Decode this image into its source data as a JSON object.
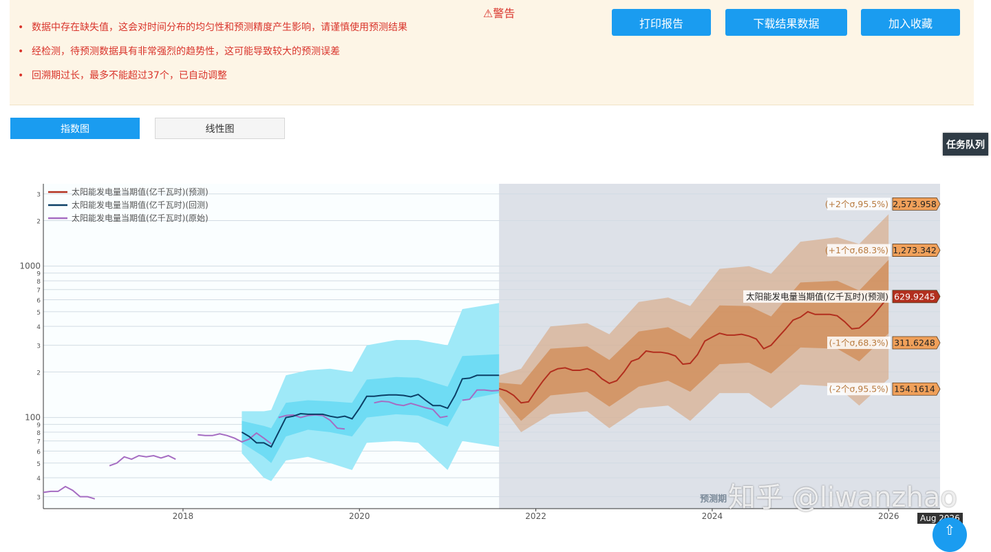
{
  "warning": {
    "title": "⚠警告",
    "items": [
      "数据中存在缺失值，这会对时间分布的均匀性和预测精度产生影响，请谨慎使用预测结果",
      "经检测，待预测数据具有非常强烈的趋势性，这可能导致较大的预测误差",
      "回溯期过长，最多不能超过37个，已自动调整"
    ]
  },
  "actions": {
    "print": "打印报告",
    "download": "下载结果数据",
    "favorite": "加入收藏"
  },
  "tabs": {
    "exp": "指数图",
    "linear": "线性图"
  },
  "side": {
    "queue": "任务队列"
  },
  "overlay": {
    "aug": "Aug 2026",
    "scroll_top": "⇧"
  },
  "watermark": "知乎 @liwanzhao",
  "colors": {
    "accent": "#1a9cf0",
    "pred": "#b22f1e",
    "back": "#0b3f66",
    "orig": "#a56cc2",
    "cyan": "#62dcf4",
    "orange": "#d6884a"
  },
  "chart_data": {
    "type": "line",
    "yscale": "log",
    "ylim": [
      25,
      3500
    ],
    "xlim": [
      "2016-06",
      "2026-08"
    ],
    "x_ticks": [
      "2018",
      "2020",
      "2022",
      "2024",
      "2026"
    ],
    "y_ticks": [
      {
        "v": 30,
        "t": "3"
      },
      {
        "v": 40,
        "t": "4"
      },
      {
        "v": 50,
        "t": "5"
      },
      {
        "v": 60,
        "t": "6"
      },
      {
        "v": 70,
        "t": "7"
      },
      {
        "v": 80,
        "t": "8"
      },
      {
        "v": 90,
        "t": "9"
      },
      {
        "v": 100,
        "t": "100"
      },
      {
        "v": 200,
        "t": "2"
      },
      {
        "v": 300,
        "t": "3"
      },
      {
        "v": 400,
        "t": "4"
      },
      {
        "v": 500,
        "t": "5"
      },
      {
        "v": 600,
        "t": "6"
      },
      {
        "v": 700,
        "t": "7"
      },
      {
        "v": 800,
        "t": "8"
      },
      {
        "v": 900,
        "t": "9"
      },
      {
        "v": 1000,
        "t": "1000"
      },
      {
        "v": 2000,
        "t": "2"
      },
      {
        "v": 3000,
        "t": "3"
      }
    ],
    "forecast_region_label": "预测期",
    "forecast_start": "2021-08",
    "legend": [
      {
        "name": "太阳能发电量当期值(亿千瓦时)(预测)",
        "color": "#b22f1e"
      },
      {
        "name": "太阳能发电量当期值(亿千瓦时)(回测)",
        "color": "#0b3f66"
      },
      {
        "name": "太阳能发电量当期值(亿千瓦时)(原始)",
        "color": "#a56cc2"
      }
    ],
    "series": {
      "original": [
        [
          [
            "2016-06",
            32
          ],
          [
            "2016-07",
            32.5
          ],
          [
            "2016-08",
            32.5
          ],
          [
            "2016-09",
            35
          ],
          [
            "2016-10",
            33
          ],
          [
            "2016-11",
            30
          ],
          [
            "2016-12",
            30
          ],
          [
            "2017-01",
            29
          ]
        ],
        [
          [
            "2017-03",
            48
          ],
          [
            "2017-04",
            50
          ],
          [
            "2017-05",
            55
          ],
          [
            "2017-06",
            53
          ],
          [
            "2017-07",
            56
          ],
          [
            "2017-08",
            55
          ],
          [
            "2017-09",
            56
          ],
          [
            "2017-10",
            54
          ],
          [
            "2017-11",
            56
          ],
          [
            "2017-12",
            53
          ]
        ],
        [
          [
            "2018-03",
            77
          ],
          [
            "2018-04",
            76
          ],
          [
            "2018-05",
            76
          ],
          [
            "2018-06",
            78
          ],
          [
            "2018-07",
            76
          ],
          [
            "2018-08",
            73
          ],
          [
            "2018-09",
            69
          ],
          [
            "2018-10",
            72
          ],
          [
            "2018-11",
            79
          ],
          [
            "2018-12",
            73
          ],
          [
            "2019-01",
            67
          ]
        ],
        [
          [
            "2019-02",
            100
          ],
          [
            "2019-03",
            103
          ],
          [
            "2019-04",
            104
          ],
          [
            "2019-05",
            100
          ],
          [
            "2019-06",
            103
          ],
          [
            "2019-07",
            104
          ],
          [
            "2019-08",
            103
          ],
          [
            "2019-09",
            96
          ],
          [
            "2019-10",
            85
          ],
          [
            "2019-11",
            84
          ]
        ],
        [
          [
            "2020-03",
            125
          ],
          [
            "2020-04",
            128
          ],
          [
            "2020-05",
            127
          ],
          [
            "2020-06",
            122
          ],
          [
            "2020-07",
            120
          ],
          [
            "2020-08",
            124
          ],
          [
            "2020-09",
            120
          ],
          [
            "2020-10",
            116
          ],
          [
            "2020-11",
            113
          ],
          [
            "2020-12",
            100
          ],
          [
            "2021-01",
            102
          ]
        ],
        [
          [
            "2021-03",
            130
          ],
          [
            "2021-04",
            132
          ],
          [
            "2021-05",
            152
          ],
          [
            "2021-06",
            152
          ],
          [
            "2021-07",
            150
          ],
          [
            "2021-08",
            151
          ]
        ]
      ],
      "backtest": [
        [
          "2018-09",
          80
        ],
        [
          "2018-10",
          75
        ],
        [
          "2018-11",
          68
        ],
        [
          "2018-12",
          68
        ],
        [
          "2019-01",
          64
        ],
        [
          "2019-02",
          80
        ],
        [
          "2019-03",
          100
        ],
        [
          "2019-04",
          102
        ],
        [
          "2019-05",
          106
        ],
        [
          "2019-06",
          105
        ],
        [
          "2019-07",
          105
        ],
        [
          "2019-08",
          105
        ],
        [
          "2019-09",
          102
        ],
        [
          "2019-10",
          100
        ],
        [
          "2019-11",
          102
        ],
        [
          "2019-12",
          98
        ],
        [
          "2020-01",
          115
        ],
        [
          "2020-02",
          138
        ],
        [
          "2020-03",
          138
        ],
        [
          "2020-04",
          140
        ],
        [
          "2020-05",
          141
        ],
        [
          "2020-06",
          141
        ],
        [
          "2020-07",
          140
        ],
        [
          "2020-08",
          137
        ],
        [
          "2020-09",
          142
        ],
        [
          "2020-10",
          130
        ],
        [
          "2020-11",
          120
        ],
        [
          "2020-12",
          120
        ],
        [
          "2021-01",
          115
        ],
        [
          "2021-02",
          140
        ],
        [
          "2021-03",
          180
        ],
        [
          "2021-04",
          182
        ],
        [
          "2021-05",
          190
        ],
        [
          "2021-06",
          190
        ],
        [
          "2021-07",
          190
        ],
        [
          "2021-08",
          190
        ]
      ],
      "backtest_band1": {
        "lower": [
          [
            "2018-09",
            68
          ],
          [
            "2018-12",
            55
          ],
          [
            "2019-01",
            50
          ],
          [
            "2019-03",
            75
          ],
          [
            "2019-06",
            83
          ],
          [
            "2019-09",
            80
          ],
          [
            "2019-12",
            75
          ],
          [
            "2020-02",
            100
          ],
          [
            "2020-06",
            105
          ],
          [
            "2020-09",
            103
          ],
          [
            "2021-01",
            87
          ],
          [
            "2021-03",
            130
          ],
          [
            "2021-08",
            145
          ]
        ],
        "upper": [
          [
            "2018-09",
            95
          ],
          [
            "2018-12",
            88
          ],
          [
            "2019-01",
            85
          ],
          [
            "2019-03",
            125
          ],
          [
            "2019-06",
            130
          ],
          [
            "2019-09",
            128
          ],
          [
            "2019-12",
            125
          ],
          [
            "2020-02",
            178
          ],
          [
            "2020-06",
            185
          ],
          [
            "2020-09",
            183
          ],
          [
            "2021-01",
            160
          ],
          [
            "2021-03",
            255
          ],
          [
            "2021-08",
            262
          ]
        ]
      },
      "backtest_band2": {
        "lower": [
          [
            "2018-09",
            58
          ],
          [
            "2018-12",
            40
          ],
          [
            "2019-01",
            38
          ],
          [
            "2019-03",
            52
          ],
          [
            "2019-06",
            55
          ],
          [
            "2019-09",
            50
          ],
          [
            "2019-12",
            45
          ],
          [
            "2020-02",
            68
          ],
          [
            "2020-06",
            70
          ],
          [
            "2020-09",
            68
          ],
          [
            "2021-01",
            45
          ],
          [
            "2021-03",
            70
          ],
          [
            "2021-08",
            64
          ]
        ],
        "upper": [
          [
            "2018-09",
            110
          ],
          [
            "2018-12",
            110
          ],
          [
            "2019-01",
            112
          ],
          [
            "2019-03",
            190
          ],
          [
            "2019-06",
            205
          ],
          [
            "2019-09",
            210
          ],
          [
            "2019-12",
            200
          ],
          [
            "2020-02",
            300
          ],
          [
            "2020-06",
            325
          ],
          [
            "2020-09",
            325
          ],
          [
            "2021-01",
            300
          ],
          [
            "2021-03",
            520
          ],
          [
            "2021-08",
            570
          ]
        ]
      },
      "forecast": [
        [
          "2021-08",
          155
        ],
        [
          "2021-09",
          150
        ],
        [
          "2021-10",
          140
        ],
        [
          "2021-11",
          125
        ],
        [
          "2021-12",
          127
        ],
        [
          "2022-01",
          150
        ],
        [
          "2022-02",
          175
        ],
        [
          "2022-03",
          200
        ],
        [
          "2022-04",
          210
        ],
        [
          "2022-05",
          213
        ],
        [
          "2022-06",
          205
        ],
        [
          "2022-07",
          205
        ],
        [
          "2022-08",
          210
        ],
        [
          "2022-09",
          200
        ],
        [
          "2022-10",
          180
        ],
        [
          "2022-11",
          168
        ],
        [
          "2022-12",
          175
        ],
        [
          "2023-01",
          200
        ],
        [
          "2023-02",
          235
        ],
        [
          "2023-03",
          245
        ],
        [
          "2023-04",
          275
        ],
        [
          "2023-05",
          270
        ],
        [
          "2023-06",
          270
        ],
        [
          "2023-07",
          265
        ],
        [
          "2023-08",
          255
        ],
        [
          "2023-09",
          225
        ],
        [
          "2023-10",
          228
        ],
        [
          "2023-11",
          260
        ],
        [
          "2023-12",
          320
        ],
        [
          "2024-01",
          340
        ],
        [
          "2024-02",
          360
        ],
        [
          "2024-03",
          350
        ],
        [
          "2024-04",
          350
        ],
        [
          "2024-05",
          355
        ],
        [
          "2024-06",
          345
        ],
        [
          "2024-07",
          330
        ],
        [
          "2024-08",
          285
        ],
        [
          "2024-09",
          300
        ],
        [
          "2024-10",
          340
        ],
        [
          "2024-11",
          385
        ],
        [
          "2024-12",
          440
        ],
        [
          "2025-01",
          460
        ],
        [
          "2025-02",
          500
        ],
        [
          "2025-03",
          480
        ],
        [
          "2025-04",
          480
        ],
        [
          "2025-05",
          480
        ],
        [
          "2025-06",
          470
        ],
        [
          "2025-07",
          430
        ],
        [
          "2025-08",
          385
        ],
        [
          "2025-09",
          390
        ],
        [
          "2025-10",
          430
        ],
        [
          "2025-11",
          480
        ],
        [
          "2025-12",
          550
        ],
        [
          "2026-01",
          630
        ]
      ],
      "forecast_band1": {
        "lower": [
          [
            "2021-08",
            140
          ],
          [
            "2021-11",
            95
          ],
          [
            "2022-03",
            140
          ],
          [
            "2022-08",
            148
          ],
          [
            "2022-11",
            118
          ],
          [
            "2023-03",
            160
          ],
          [
            "2023-07",
            175
          ],
          [
            "2023-10",
            148
          ],
          [
            "2024-02",
            225
          ],
          [
            "2024-06",
            230
          ],
          [
            "2024-09",
            195
          ],
          [
            "2025-01",
            290
          ],
          [
            "2025-06",
            285
          ],
          [
            "2025-09",
            235
          ],
          [
            "2026-01",
            360
          ]
        ],
        "upper": [
          [
            "2021-08",
            170
          ],
          [
            "2021-11",
            165
          ],
          [
            "2022-03",
            285
          ],
          [
            "2022-08",
            295
          ],
          [
            "2022-11",
            240
          ],
          [
            "2023-03",
            370
          ],
          [
            "2023-07",
            395
          ],
          [
            "2023-10",
            330
          ],
          [
            "2024-02",
            550
          ],
          [
            "2024-06",
            545
          ],
          [
            "2024-09",
            465
          ],
          [
            "2025-01",
            780
          ],
          [
            "2025-06",
            800
          ],
          [
            "2025-09",
            690
          ],
          [
            "2026-01",
            1100
          ]
        ]
      },
      "forecast_band2": {
        "lower": [
          [
            "2021-08",
            125
          ],
          [
            "2021-11",
            80
          ],
          [
            "2022-03",
            105
          ],
          [
            "2022-08",
            110
          ],
          [
            "2022-11",
            85
          ],
          [
            "2023-03",
            115
          ],
          [
            "2023-07",
            120
          ],
          [
            "2023-10",
            95
          ],
          [
            "2024-02",
            145
          ],
          [
            "2024-06",
            145
          ],
          [
            "2024-09",
            115
          ],
          [
            "2025-01",
            165
          ],
          [
            "2025-06",
            160
          ],
          [
            "2025-09",
            120
          ],
          [
            "2026-01",
            180
          ]
        ],
        "upper": [
          [
            "2021-08",
            190
          ],
          [
            "2021-11",
            210
          ],
          [
            "2022-03",
            400
          ],
          [
            "2022-08",
            420
          ],
          [
            "2022-11",
            355
          ],
          [
            "2023-03",
            580
          ],
          [
            "2023-07",
            620
          ],
          [
            "2023-10",
            545
          ],
          [
            "2024-02",
            960
          ],
          [
            "2024-06",
            1000
          ],
          [
            "2024-09",
            890
          ],
          [
            "2025-01",
            1450
          ],
          [
            "2025-06",
            1550
          ],
          [
            "2025-09",
            1400
          ],
          [
            "2026-01",
            2200
          ]
        ]
      }
    },
    "end_labels": [
      {
        "label": "(+2个σ,95.5%)",
        "value": "2,573.958",
        "v": 2573.958
      },
      {
        "label": "(+1个σ,68.3%)",
        "value": "1,273.342",
        "v": 1273.342
      },
      {
        "label": "太阳能发电量当期值(亿千瓦时)(预测)",
        "value": "629.9245",
        "v": 629.9245,
        "main": true
      },
      {
        "label": "(-1个σ,68.3%)",
        "value": "311.6248",
        "v": 311.6248
      },
      {
        "label": "(-2个σ,95.5%)",
        "value": "154.1614",
        "v": 154.1614
      }
    ]
  }
}
